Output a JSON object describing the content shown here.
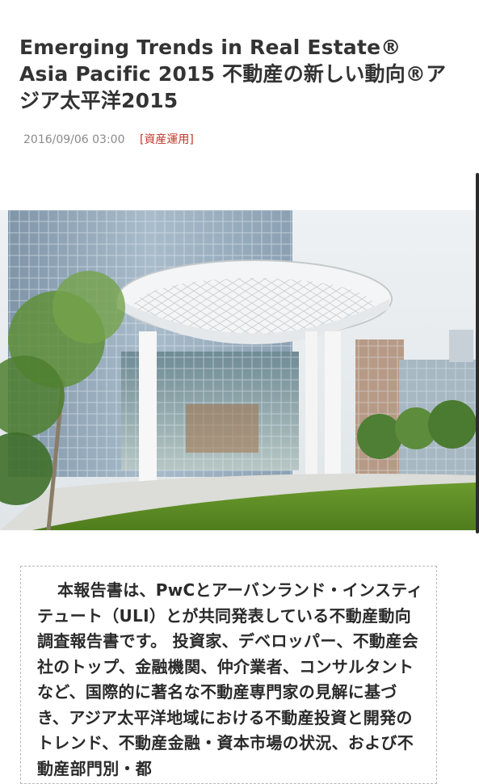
{
  "article": {
    "title": "Emerging Trends in Real Estate® Asia Pacific 2015 不動産の新しい動向®アジア太平洋2015",
    "date": "2016/09/06 03:00",
    "category": "[資産運用]",
    "body": "本報告書は、PwCとアーバンランド・インスティテュート（ULI）とが共同発表している不動産動向調査報告書です。 投資家、デベロッパー、不動産会社のトップ、金融機関、仲介業者、コンサルタントなど、国際的に著名な不動産専門家の見解に基づき、アジア太平洋地域における不動産投資と開発のトレンド、不動産金融・資本市場の状況、および不動産部門別・都"
  },
  "colors": {
    "title": "#333333",
    "meta": "#8a8a8a",
    "category": "#c0392b",
    "body_text": "#2a2a2a",
    "border": "#b8b8b8"
  }
}
